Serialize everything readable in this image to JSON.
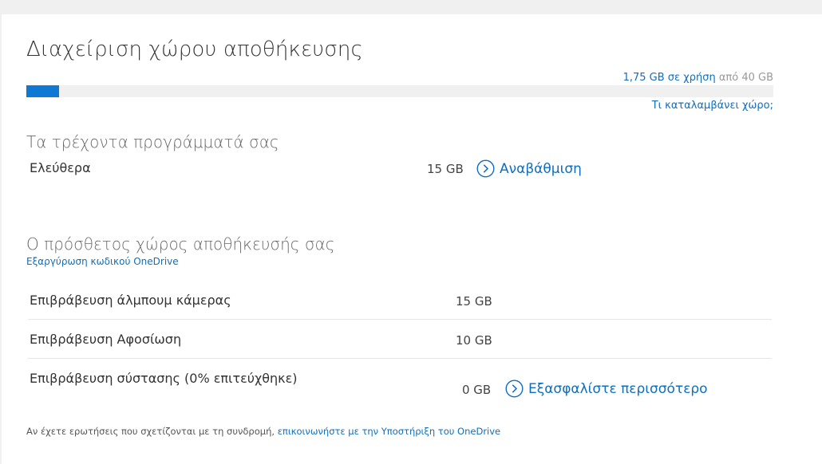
{
  "page": {
    "title": "Διαχείριση χώρου αποθήκευσης"
  },
  "usage": {
    "used_text": "1,75 GB σε χρήση",
    "total_text": "από 40 GB",
    "used_fraction": 0.044,
    "what_link": "Τι καταλαμβάνει χώρο;"
  },
  "plans": {
    "title": "Τα τρέχοντα προγράμματά σας",
    "items": [
      {
        "name": "Ελεύθερα",
        "size": "15 GB",
        "action": "Αναβάθμιση"
      }
    ]
  },
  "bonus": {
    "title": "Ο πρόσθετος χώρος αποθήκευσής σας",
    "redeem_link": "Εξαργύρωση κωδικού OneDrive",
    "rows": [
      {
        "label": "Επιβράβευση άλμπουμ κάμερας",
        "size": "15 GB"
      },
      {
        "label": "Επιβράβευση Αφοσίωση",
        "size": "10 GB"
      },
      {
        "label": "Επιβράβευση σύστασης (0% επιτεύχθηκε)",
        "size": "0 GB",
        "action": "Εξασφαλίστε περισσότερο"
      }
    ]
  },
  "footer": {
    "text": "Αν έχετε ερωτήσεις που σχετίζονται με τη συνδρομή,",
    "link": "επικοινωνήστε με την Υποστήριξη του OneDrive"
  },
  "colors": {
    "accent": "#106ebe",
    "bar_fill": "#0f78d4",
    "bar_track": "#f0f0f0"
  },
  "icons": {
    "action": "chevron-right-circle-icon"
  }
}
